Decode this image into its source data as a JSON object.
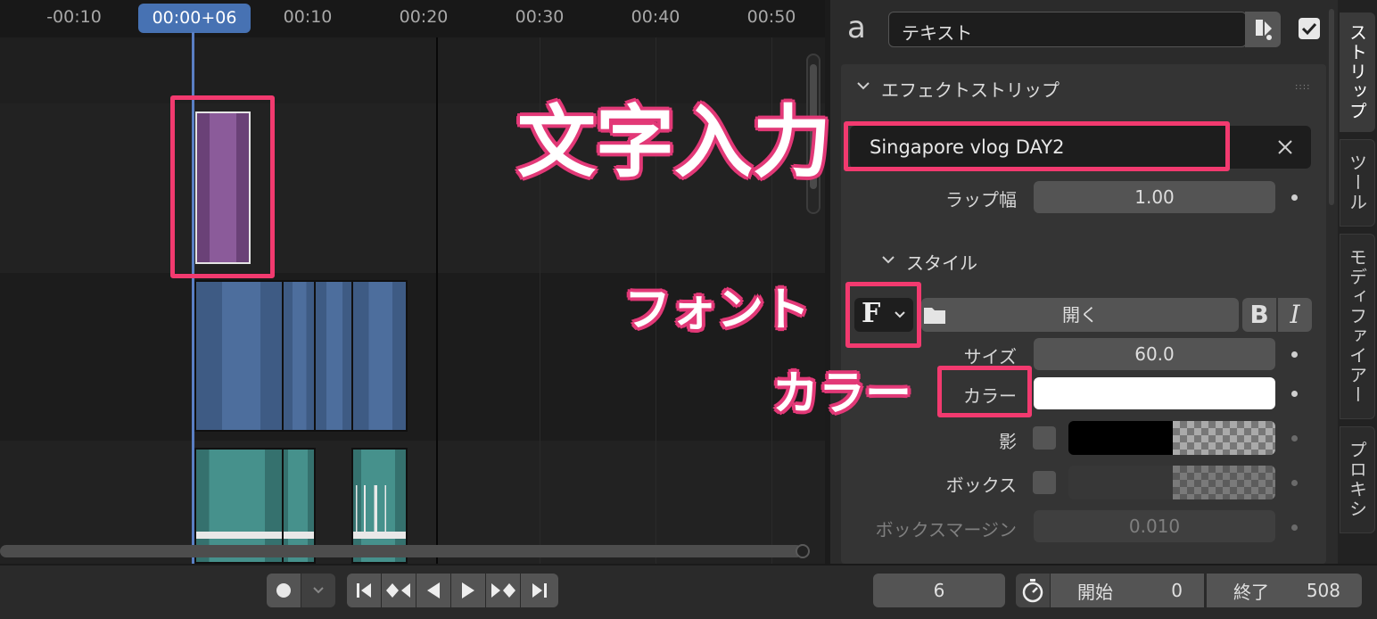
{
  "timeline": {
    "ruler_ticks": [
      "-00:10",
      "00:10",
      "00:20",
      "00:30",
      "00:40",
      "00:50"
    ],
    "playhead_label": "00:00+06"
  },
  "panel": {
    "strip_name": "テキスト",
    "section_title": "エフェクトストリップ",
    "text_value": "Singapore vlog DAY2",
    "wrap_label": "ラップ幅",
    "wrap_value": "1.00",
    "style_title": "スタイル",
    "font_button": "F",
    "open_label": "開く",
    "bold_label": "B",
    "italic_label": "I",
    "size_label": "サイズ",
    "size_value": "60.0",
    "color_label": "カラー",
    "shadow_label": "影",
    "box_label": "ボックス",
    "box_margin_label": "ボックスマージン",
    "box_margin_value": "0.010"
  },
  "tabs": [
    "ストリップ",
    "ツール",
    "モディファイアー",
    "プロキシ"
  ],
  "callouts": {
    "text_input": "文字入力",
    "font": "フォント",
    "color": "カラー"
  },
  "bottom": {
    "current_frame": "6",
    "start_label": "開始",
    "start_value": "0",
    "end_label": "終了",
    "end_value": "508"
  },
  "colors": {
    "accent": "#4772b3",
    "annotation": "#f23a6f",
    "text_color_swatch": "#ffffff",
    "shadow_color_swatch": "#000000"
  }
}
